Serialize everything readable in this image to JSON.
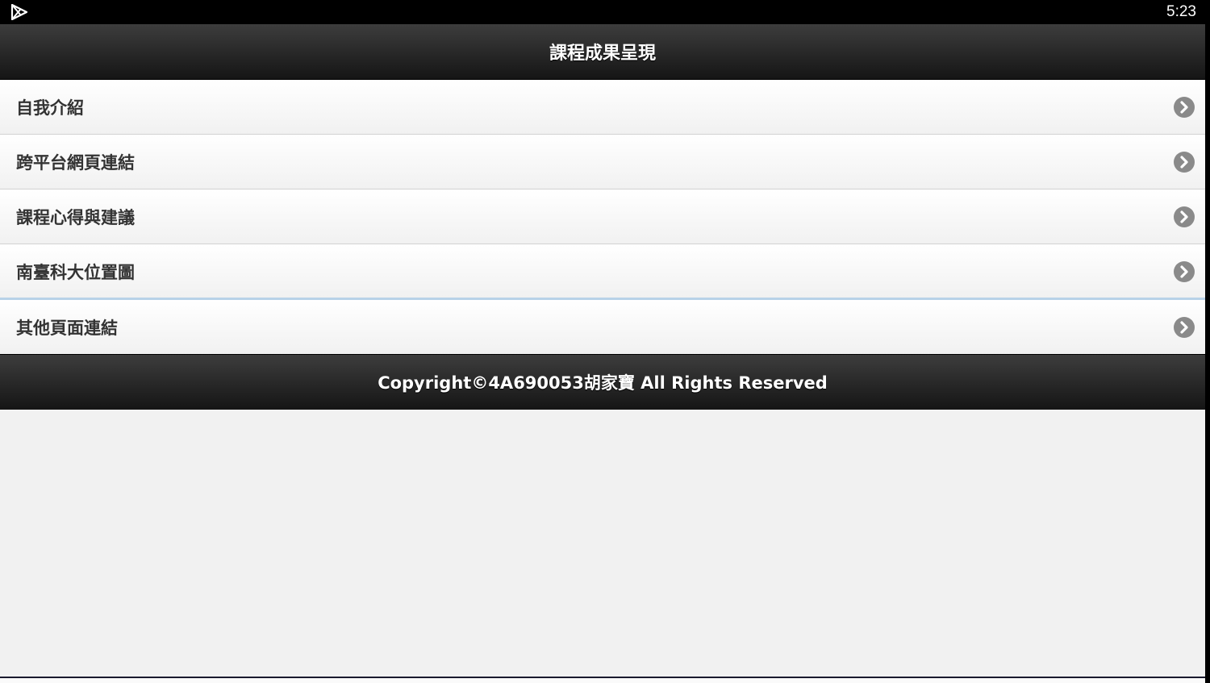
{
  "status_bar": {
    "time": "5:23",
    "app_icon": "play-store-icon"
  },
  "header": {
    "title": "課程成果呈現"
  },
  "menu": {
    "items": [
      {
        "label": "自我介紹",
        "icon": "chevron-right-circle-icon"
      },
      {
        "label": "跨平台網頁連結",
        "icon": "chevron-right-circle-icon"
      },
      {
        "label": "課程心得與建議",
        "icon": "chevron-right-circle-icon"
      },
      {
        "label": "南臺科大位置圖",
        "icon": "chevron-right-circle-icon"
      },
      {
        "label": "其他頁面連結",
        "icon": "chevron-right-circle-icon"
      }
    ]
  },
  "footer": {
    "copyright": "Copyright©4A690053胡家寶 All Rights Reserved"
  },
  "colors": {
    "bar_dark": "#151515",
    "list_bg": "#ffffff",
    "page_bg": "#f1f1f1",
    "text": "#333333",
    "icon_bg": "#8a8a8a",
    "highlight": "#b8d2e8"
  }
}
